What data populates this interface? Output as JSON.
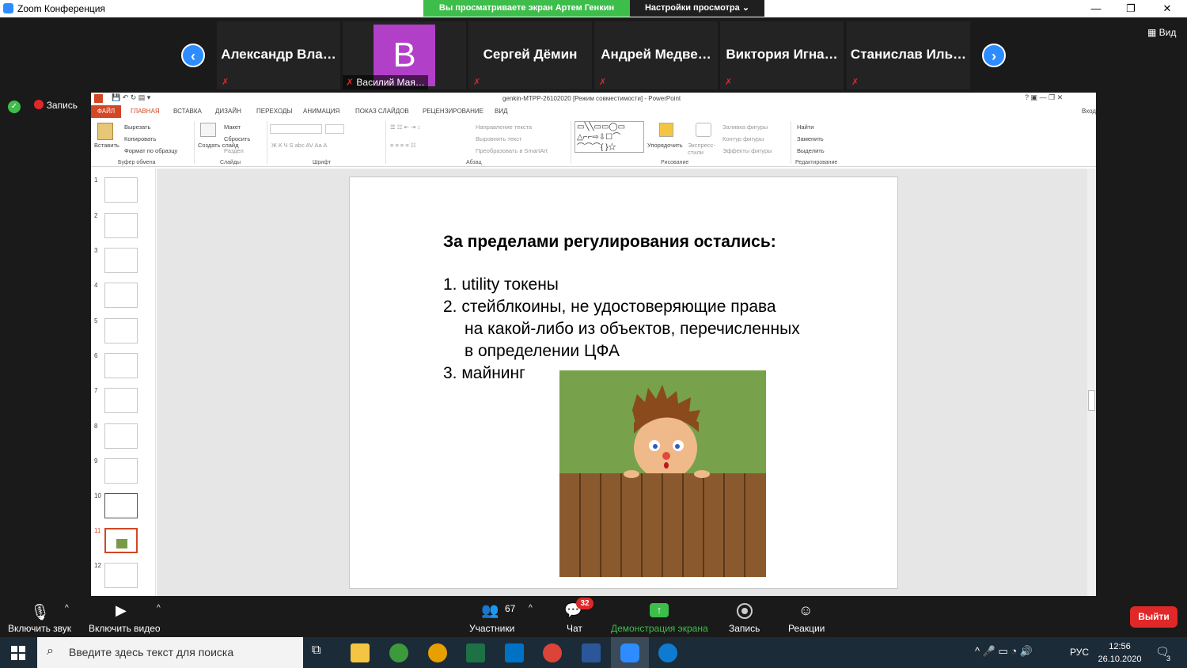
{
  "zoom": {
    "window_title": "Zoom Конференция",
    "share_banner": "Вы просматриваете экран Артем Генкин",
    "view_options": "Настройки просмотра",
    "view_label": "Вид",
    "record_label": "Запись",
    "participants": [
      {
        "name": "Александр  Вла…",
        "avatar_letter": ""
      },
      {
        "name": "Василий Мая…",
        "avatar_letter": "В"
      },
      {
        "name": "Сергей Дёмин",
        "avatar_letter": ""
      },
      {
        "name": "Андрей  Медве…",
        "avatar_letter": ""
      },
      {
        "name": "Виктория  Игна…",
        "avatar_letter": ""
      },
      {
        "name": "Станислав  Иль…",
        "avatar_letter": ""
      }
    ],
    "toolbar": {
      "unmute": "Включить звук",
      "start_video": "Включить видео",
      "participants": "Участники",
      "participants_count": "67",
      "chat": "Чат",
      "chat_badge": "32",
      "share_screen": "Демонстрация экрана",
      "record": "Запись",
      "reactions": "Реакции",
      "leave": "Выйти"
    }
  },
  "ppt": {
    "window_title": "genkin-МТРР-26102020 [Режим совместимости] - PowerPoint",
    "login": "Вход",
    "tabs": [
      "ФАЙЛ",
      "ГЛАВНАЯ",
      "ВСТАВКА",
      "ДИЗАЙН",
      "ПЕРЕХОДЫ",
      "АНИМАЦИЯ",
      "ПОКАЗ СЛАЙДОВ",
      "РЕЦЕНЗИРОВАНИЕ",
      "ВИД"
    ],
    "ribbon": {
      "paste": "Вставить",
      "cut": "Вырезать",
      "copy": "Копировать",
      "format_painter": "Формат по образцу",
      "clipboard": "Буфер обмена",
      "new_slide": "Создать слайд",
      "layout": "Макет",
      "reset": "Сбросить",
      "section": "Раздел",
      "slides": "Слайды",
      "font": "Шрифт",
      "text_direction": "Направление текста",
      "align_text": "Выровнять текст",
      "smartart": "Преобразовать в SmartArt",
      "paragraph": "Абзац",
      "arrange": "Упорядочить",
      "quick_styles": "Экспресс-стили",
      "shape_fill": "Заливка фигуры",
      "shape_outline": "Контур фигуры",
      "shape_effects": "Эффекты фигуры",
      "drawing": "Рисование",
      "find": "Найти",
      "replace": "Заменить",
      "select": "Выделить",
      "editing": "Редактирование"
    },
    "thumbnails": [
      "1",
      "2",
      "3",
      "4",
      "5",
      "6",
      "7",
      "8",
      "9",
      "10",
      "11",
      "12"
    ],
    "selected_slide": "11",
    "slide": {
      "title": "За пределами регулирования остались:",
      "items": [
        "1.  utility токены",
        "2. стейблкоины, не удостоверяющие права",
        "на какой-либо из объектов, перечисленных",
        "в определении ЦФА",
        "3. майнинг"
      ]
    }
  },
  "taskbar": {
    "search_placeholder": "Введите здесь текст для поиска",
    "language": "РУС",
    "time": "12:56",
    "date": "26.10.2020",
    "notifications": "3"
  },
  "colors": {
    "zoom_blue": "#2d8cff",
    "share_green": "#3dbd4a",
    "leave_red": "#e02828",
    "ppt_orange": "#d24726",
    "avatar_purple": "#b23fc8"
  }
}
